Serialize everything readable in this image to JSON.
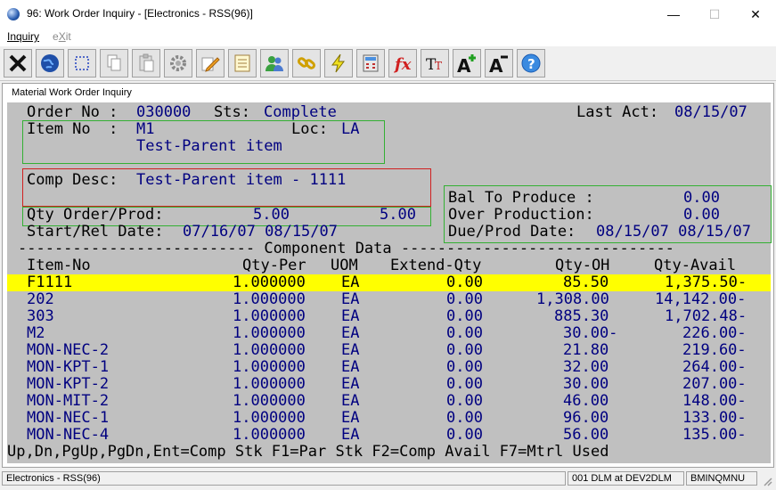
{
  "window": {
    "title": "96: Work Order Inquiry - [Electronics - RSS(96)]",
    "minimize": "—",
    "maximize": "☐",
    "close": "✕"
  },
  "menu": {
    "inquiry": "Inquiry",
    "exit_prefix": "e",
    "exit_accel": "X",
    "exit_suffix": "it"
  },
  "toolbar": {
    "buttons": [
      "close-icon",
      "globe-icon",
      "select-box-icon",
      "copy-icon",
      "paste-icon",
      "settings-gear-icon",
      "edit-pencil-icon",
      "notepad-icon",
      "users-icon",
      "chain-link-icon",
      "lightning-icon",
      "calculator-icon",
      "formula-fx-icon",
      "text-size-icon",
      "font-increase-icon",
      "font-decrease-icon",
      "help-icon"
    ]
  },
  "panel": {
    "title": "Material Work Order Inquiry"
  },
  "header": {
    "order_label": "Order No : ",
    "order_value": "030000",
    "sts_label": "Sts:",
    "sts_value": "Complete",
    "last_act_label": "Last Act:",
    "last_act_value": "08/15/07",
    "item_label": "Item No  :",
    "item_value": "M1",
    "loc_label": "Loc:",
    "loc_value": "LA",
    "item_desc": "Test-Parent item",
    "comp_desc_label": "Comp Desc:",
    "comp_desc_value": "Test-Parent item - 1111",
    "qty_label": "Qty Order/Prod:",
    "qty_order": "5.00",
    "qty_prod": "5.00",
    "start_label": "Start/Rel Date:",
    "start_value": "07/16/07 08/15/07",
    "bal_label": "Bal To Produce :",
    "bal_value": "0.00",
    "over_label": "Over Production:",
    "over_value": "0.00",
    "due_label": "Due/Prod Date:",
    "due_value": "08/15/07 08/15/07"
  },
  "component_divider": "-------------------------- Component Data ------------------------------",
  "columns": {
    "item": "Item-No",
    "qty_per": "Qty-Per",
    "uom": "UOM",
    "extend_qty": "Extend-Qty",
    "qty_oh": "Qty-OH",
    "qty_avail": "Qty-Avail"
  },
  "rows": [
    {
      "item": "F1111",
      "qty_per": "1.000000",
      "uom": "EA",
      "extend": "0.00",
      "oh": "85.50",
      "avail": "1,375.50-"
    },
    {
      "item": "202",
      "qty_per": "1.000000",
      "uom": "EA",
      "extend": "0.00",
      "oh": "1,308.00",
      "avail": "14,142.00-"
    },
    {
      "item": "303",
      "qty_per": "1.000000",
      "uom": "EA",
      "extend": "0.00",
      "oh": "885.30",
      "avail": "1,702.48-"
    },
    {
      "item": "M2",
      "qty_per": "1.000000",
      "uom": "EA",
      "extend": "0.00",
      "oh": "30.00-",
      "avail": "226.00-"
    },
    {
      "item": "MON-NEC-2",
      "qty_per": "1.000000",
      "uom": "EA",
      "extend": "0.00",
      "oh": "21.80",
      "avail": "219.60-"
    },
    {
      "item": "MON-KPT-1",
      "qty_per": "1.000000",
      "uom": "EA",
      "extend": "0.00",
      "oh": "32.00",
      "avail": "264.00-"
    },
    {
      "item": "MON-KPT-2",
      "qty_per": "1.000000",
      "uom": "EA",
      "extend": "0.00",
      "oh": "30.00",
      "avail": "207.00-"
    },
    {
      "item": "MON-MIT-2",
      "qty_per": "1.000000",
      "uom": "EA",
      "extend": "0.00",
      "oh": "46.00",
      "avail": "148.00-"
    },
    {
      "item": "MON-NEC-1",
      "qty_per": "1.000000",
      "uom": "EA",
      "extend": "0.00",
      "oh": "96.00",
      "avail": "133.00-"
    },
    {
      "item": "MON-NEC-4",
      "qty_per": "1.000000",
      "uom": "EA",
      "extend": "0.00",
      "oh": "56.00",
      "avail": "135.00-"
    }
  ],
  "footer_keys": "Up,Dn,PgUp,PgDn,Ent=Comp Stk F1=Par Stk F2=Comp Avail F7=Mtrl Used",
  "status": {
    "company": "Electronics - RSS(96)",
    "session": "001 DLM at DEV2DLM",
    "program": "BMINQMNU"
  },
  "colors": {
    "terminal_bg": "#c0c0c0",
    "value_text": "#000080",
    "selected_row": "#ffff00",
    "group_box": "#33b033",
    "focus_box": "#d02020"
  }
}
